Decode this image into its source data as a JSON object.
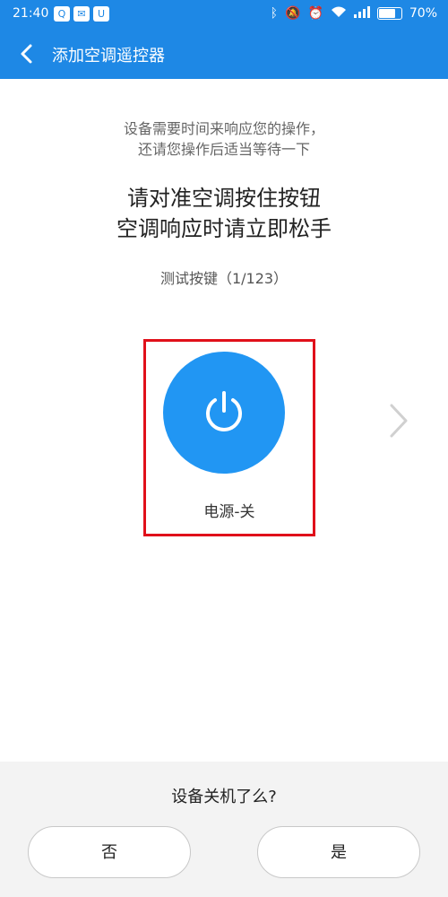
{
  "status_bar": {
    "time": "21:40",
    "battery": "70%",
    "battery_level": 0.7,
    "apps": [
      "qq-icon",
      "wechat-icon",
      "shield-app-icon"
    ]
  },
  "header": {
    "title": "添加空调遥控器"
  },
  "main": {
    "hint_line1": "设备需要时间来响应您的操作，",
    "hint_line2": "还请您操作后适当等待一下",
    "instruction_line1": "请对准空调按住按钮",
    "instruction_line2": "空调响应时请立即松手",
    "progress": "测试按键（1/123）",
    "button_label": "电源-关",
    "accent_color": "#2196f3",
    "highlight_color": "#e0101a"
  },
  "footer": {
    "question": "设备关机了么?",
    "no_label": "否",
    "yes_label": "是"
  }
}
